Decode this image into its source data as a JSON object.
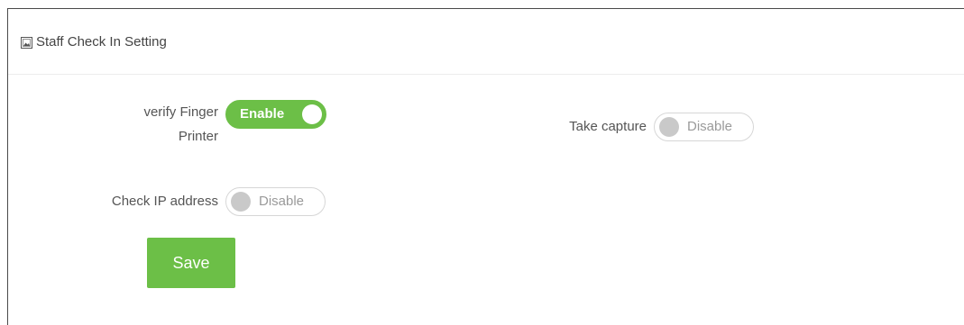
{
  "header": {
    "icon": "image-icon",
    "title": "Staff Check In Setting"
  },
  "settings": {
    "verify_finger_printer": {
      "label_line1": "verify Finger",
      "label_line2": "Printer",
      "state": "Enable",
      "enabled": true
    },
    "take_capture": {
      "label": "Take capture",
      "state": "Disable",
      "enabled": false
    },
    "check_ip_address": {
      "label": "Check IP address",
      "state": "Disable",
      "enabled": false
    }
  },
  "actions": {
    "save_label": "Save"
  },
  "colors": {
    "accent": "#6cbf47",
    "toggle_off_knob": "#c9c9c9",
    "toggle_off_text": "#9a9a9a"
  }
}
